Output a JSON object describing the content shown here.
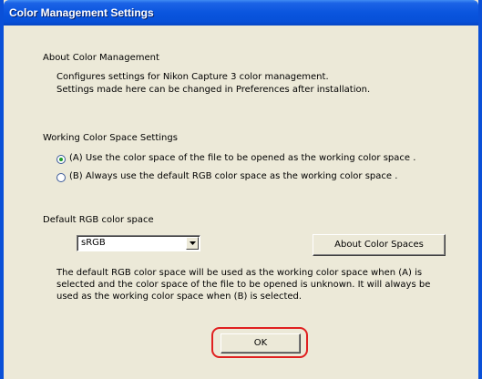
{
  "window": {
    "title": "Color Management Settings"
  },
  "about_section": {
    "heading": "About Color Management",
    "line1": "Configures settings for Nikon Capture 3 color management.",
    "line2": "Settings made here can be changed in Preferences after installation."
  },
  "working_space": {
    "heading": "Working Color Space Settings",
    "option_a": "(A) Use the color space of the file to be opened as the working color space .",
    "option_b": "(B) Always use the default RGB color space as the working color space .",
    "selected": "A"
  },
  "default_rgb": {
    "heading": "Default RGB color space",
    "selected_value": "sRGB",
    "about_button": "About Color Spaces"
  },
  "description": {
    "line1": "The default RGB color space will be used as the working color space when (A) is",
    "line2": "selected and the color space of the file to be opened is unknown. It will always be",
    "line3": "used as the working color space when (B) is selected."
  },
  "ok_button": "OK",
  "colors": {
    "title_bar": "#0a55de",
    "window_bg": "#ece9d8",
    "highlight": "#e02020",
    "radio_dot": "#1e9c2a"
  },
  "icons": [
    "radio-selected-icon",
    "radio-unselected-icon",
    "dropdown-arrow-icon"
  ]
}
